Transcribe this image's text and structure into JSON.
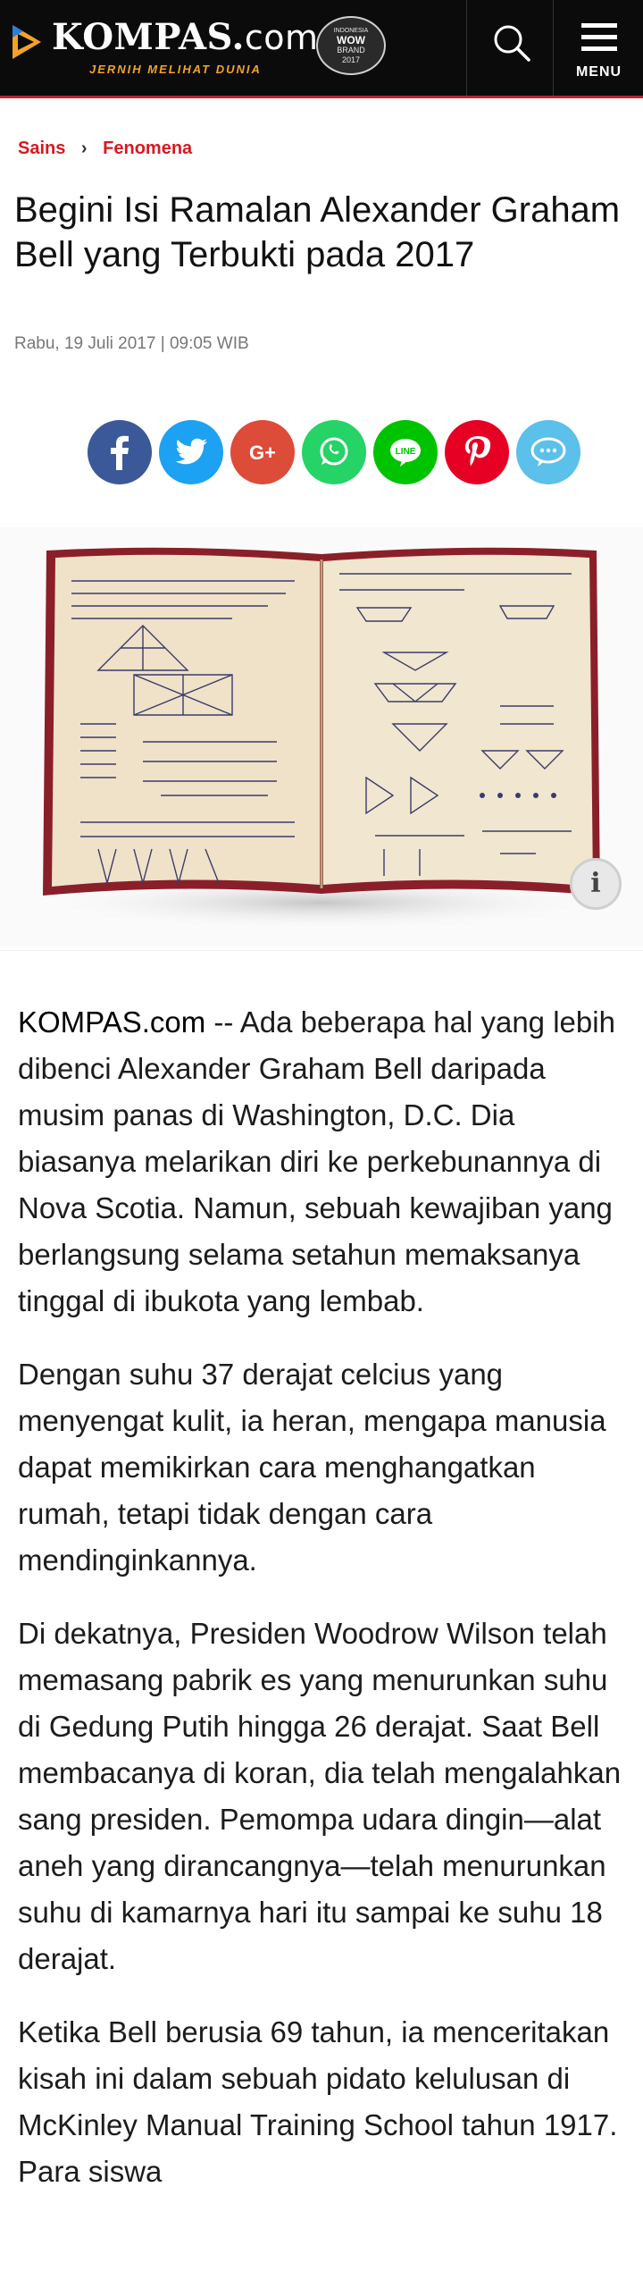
{
  "header": {
    "logo_main": "KOMPAS.",
    "logo_suffix": "com",
    "tagline": "JERNIH MELIHAT DUNIA",
    "badge_line1": "INDONESIA",
    "badge_line2": "WOW",
    "badge_line3": "BRAND",
    "badge_line4": "2017",
    "menu_label": "MENU"
  },
  "breadcrumb": {
    "section": "Sains",
    "separator": "›",
    "subsection": "Fenomena"
  },
  "article": {
    "title": "Begini Isi Ramalan Alexander Graham Bell yang Terbukti pada 2017",
    "date": "Rabu, 19 Juli 2017 | 09:05 WIB",
    "source": "KOMPAS.com",
    "paragraphs": [
      " -- Ada beberapa hal yang lebih dibenci Alexander Graham Bell daripada musim panas di Washington, D.C. Dia biasanya melarikan diri ke perkebunannya di Nova Scotia. Namun, sebuah kewajiban yang berlangsung selama setahun memaksanya tinggal di ibukota yang lembab.",
      "Dengan suhu 37 derajat celcius yang menyengat kulit, ia heran, mengapa manusia dapat memikirkan cara menghangatkan rumah, tetapi tidak dengan cara mendinginkannya.",
      "Di dekatnya, Presiden Woodrow Wilson telah memasang pabrik es yang menurunkan suhu di Gedung Putih hingga 26 derajat. Saat Bell membacanya di koran, dia telah mengalahkan sang presiden. Pemompa udara dingin—alat aneh yang dirancangnya—telah menurunkan suhu di kamarnya hari itu sampai ke suhu 18 derajat.",
      "Ketika Bell berusia 69 tahun, ia menceritakan kisah ini dalam sebuah pidato kelulusan di McKinley Manual Training School tahun 1917. Para siswa"
    ]
  },
  "share": [
    {
      "name": "facebook",
      "color": "#3b5998",
      "icon": "facebook-icon"
    },
    {
      "name": "twitter",
      "color": "#1da1f2",
      "icon": "twitter-icon"
    },
    {
      "name": "google-plus",
      "color": "#dd4b39",
      "icon": "google-plus-icon"
    },
    {
      "name": "whatsapp",
      "color": "#25d366",
      "icon": "whatsapp-icon"
    },
    {
      "name": "line",
      "color": "#00c300",
      "icon": "line-icon"
    },
    {
      "name": "pinterest",
      "color": "#e60023",
      "icon": "pinterest-icon"
    },
    {
      "name": "comment",
      "color": "#5bc0ea",
      "icon": "comment-icon"
    }
  ],
  "colors": {
    "brand_red": "#d71920",
    "header_bg": "#0b0b0b",
    "tagline_orange": "#f2a227"
  }
}
